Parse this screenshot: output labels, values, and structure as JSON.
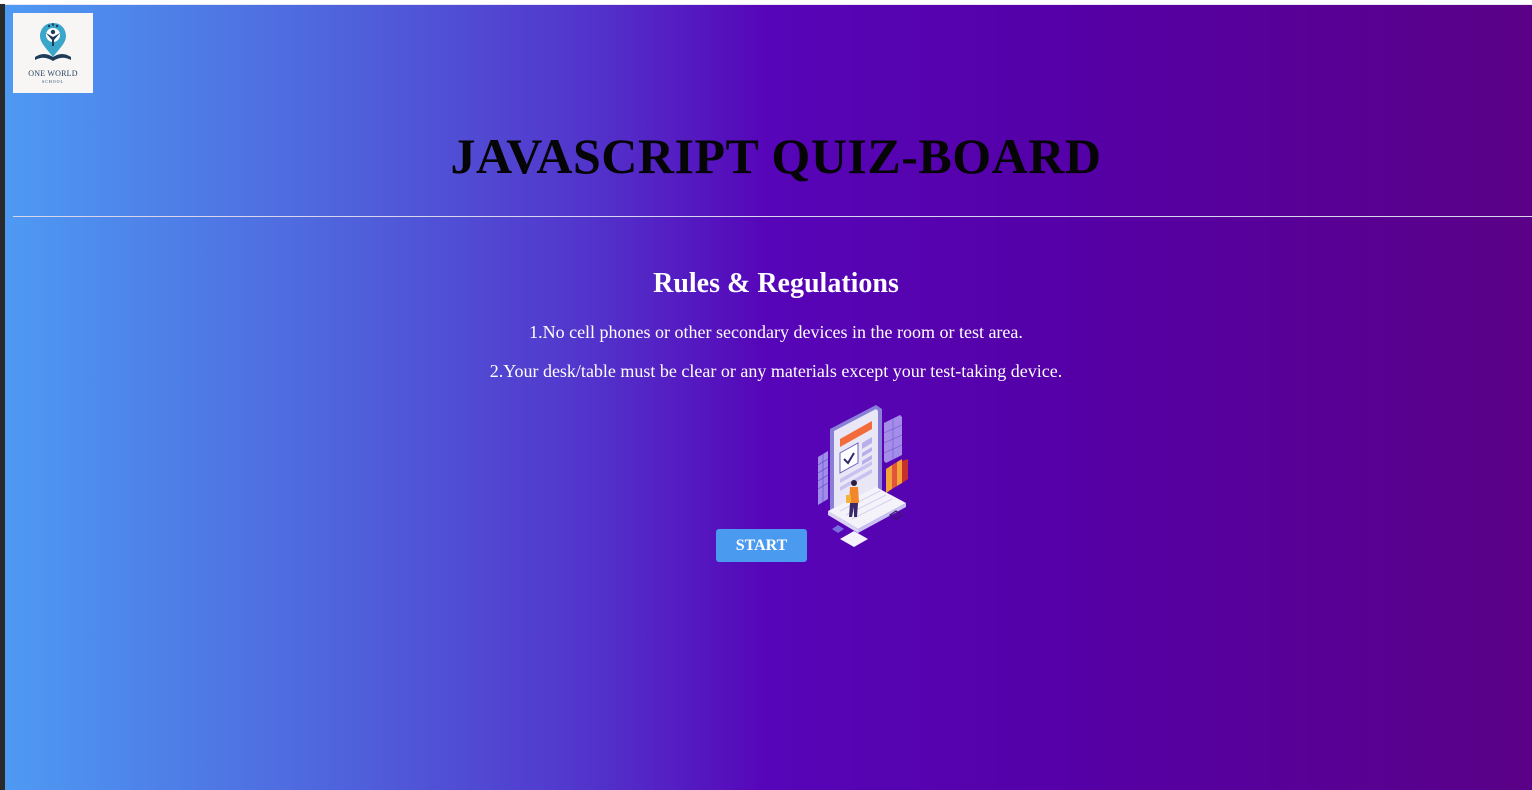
{
  "logo": {
    "name": "ONE WORLD",
    "subtitle": "SCHOOL"
  },
  "header": {
    "title": "JAVASCRIPT QUIZ-BOARD"
  },
  "rules": {
    "heading": "Rules & Regulations",
    "items": [
      "1.No cell phones or other secondary devices in the room or test area.",
      "2.Your desk/table must be clear or any materials except your test-taking device."
    ]
  },
  "actions": {
    "start_label": "START"
  },
  "colors": {
    "gradient_start": "#4e9af3",
    "gradient_mid": "#5605b8",
    "gradient_end": "#5a0187",
    "button": "#4a9af0"
  },
  "icons": {
    "logo": "school-logo-icon",
    "illustration": "computer-test-illustration"
  }
}
